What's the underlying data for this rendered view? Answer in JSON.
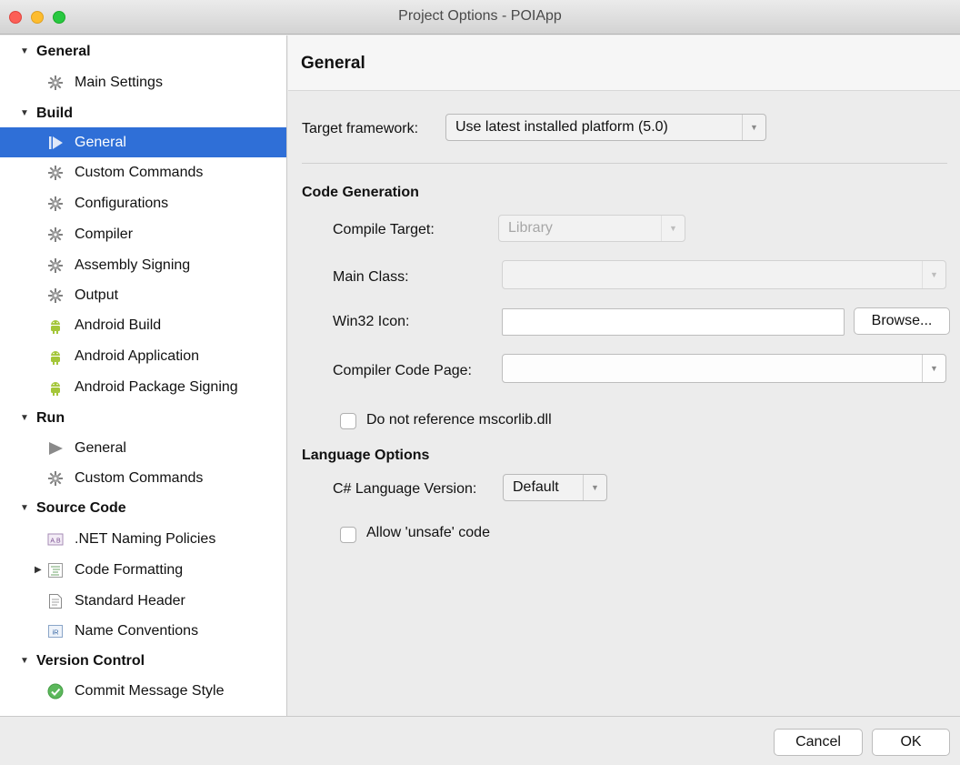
{
  "window": {
    "title": "Project Options - POIApp"
  },
  "sidebar": {
    "sections": {
      "general": "General",
      "build": "Build",
      "run": "Run",
      "source_code": "Source Code",
      "version_control": "Version Control"
    },
    "items": {
      "main_settings": "Main Settings",
      "build_general": "General",
      "build_custom_commands": "Custom Commands",
      "configurations": "Configurations",
      "compiler": "Compiler",
      "assembly_signing": "Assembly Signing",
      "output": "Output",
      "android_build": "Android Build",
      "android_application": "Android Application",
      "android_package_signing": "Android Package Signing",
      "run_general": "General",
      "run_custom_commands": "Custom Commands",
      "net_naming_policies": ".NET Naming Policies",
      "code_formatting": "Code Formatting",
      "standard_header": "Standard Header",
      "name_conventions": "Name Conventions",
      "commit_message_style": "Commit Message Style"
    },
    "selected": "build_general",
    "icons": {
      "gear": "gear-icon",
      "play": "play-icon",
      "android": "android-icon",
      "naming": "naming-policy-icon",
      "formatting": "code-formatting-icon",
      "header": "document-icon",
      "conventions": "name-conventions-icon",
      "commit": "check-circle-icon"
    }
  },
  "main": {
    "heading": "General",
    "target_framework": {
      "label": "Target framework:",
      "value": "Use latest installed platform (5.0)"
    },
    "code_generation": {
      "title": "Code Generation",
      "compile_target_label": "Compile Target:",
      "compile_target_value": "Library",
      "main_class_label": "Main Class:",
      "main_class_value": "",
      "win32_icon_label": "Win32 Icon:",
      "win32_icon_value": "",
      "browse_label": "Browse...",
      "code_page_label": "Compiler Code Page:",
      "code_page_value": "",
      "no_mscorlib_label": "Do not reference mscorlib.dll",
      "no_mscorlib_checked": false
    },
    "language_options": {
      "title": "Language Options",
      "version_label": "C# Language Version:",
      "version_value": "Default",
      "unsafe_label": "Allow 'unsafe' code",
      "unsafe_checked": false
    }
  },
  "footer": {
    "cancel_label": "Cancel",
    "ok_label": "OK"
  },
  "colors": {
    "selection": "#2f6fd7",
    "android": "#a4c639",
    "close": "#fc5f57",
    "minimize": "#fdbc2e",
    "zoom": "#28c840",
    "commit_check": "#4caf50"
  }
}
